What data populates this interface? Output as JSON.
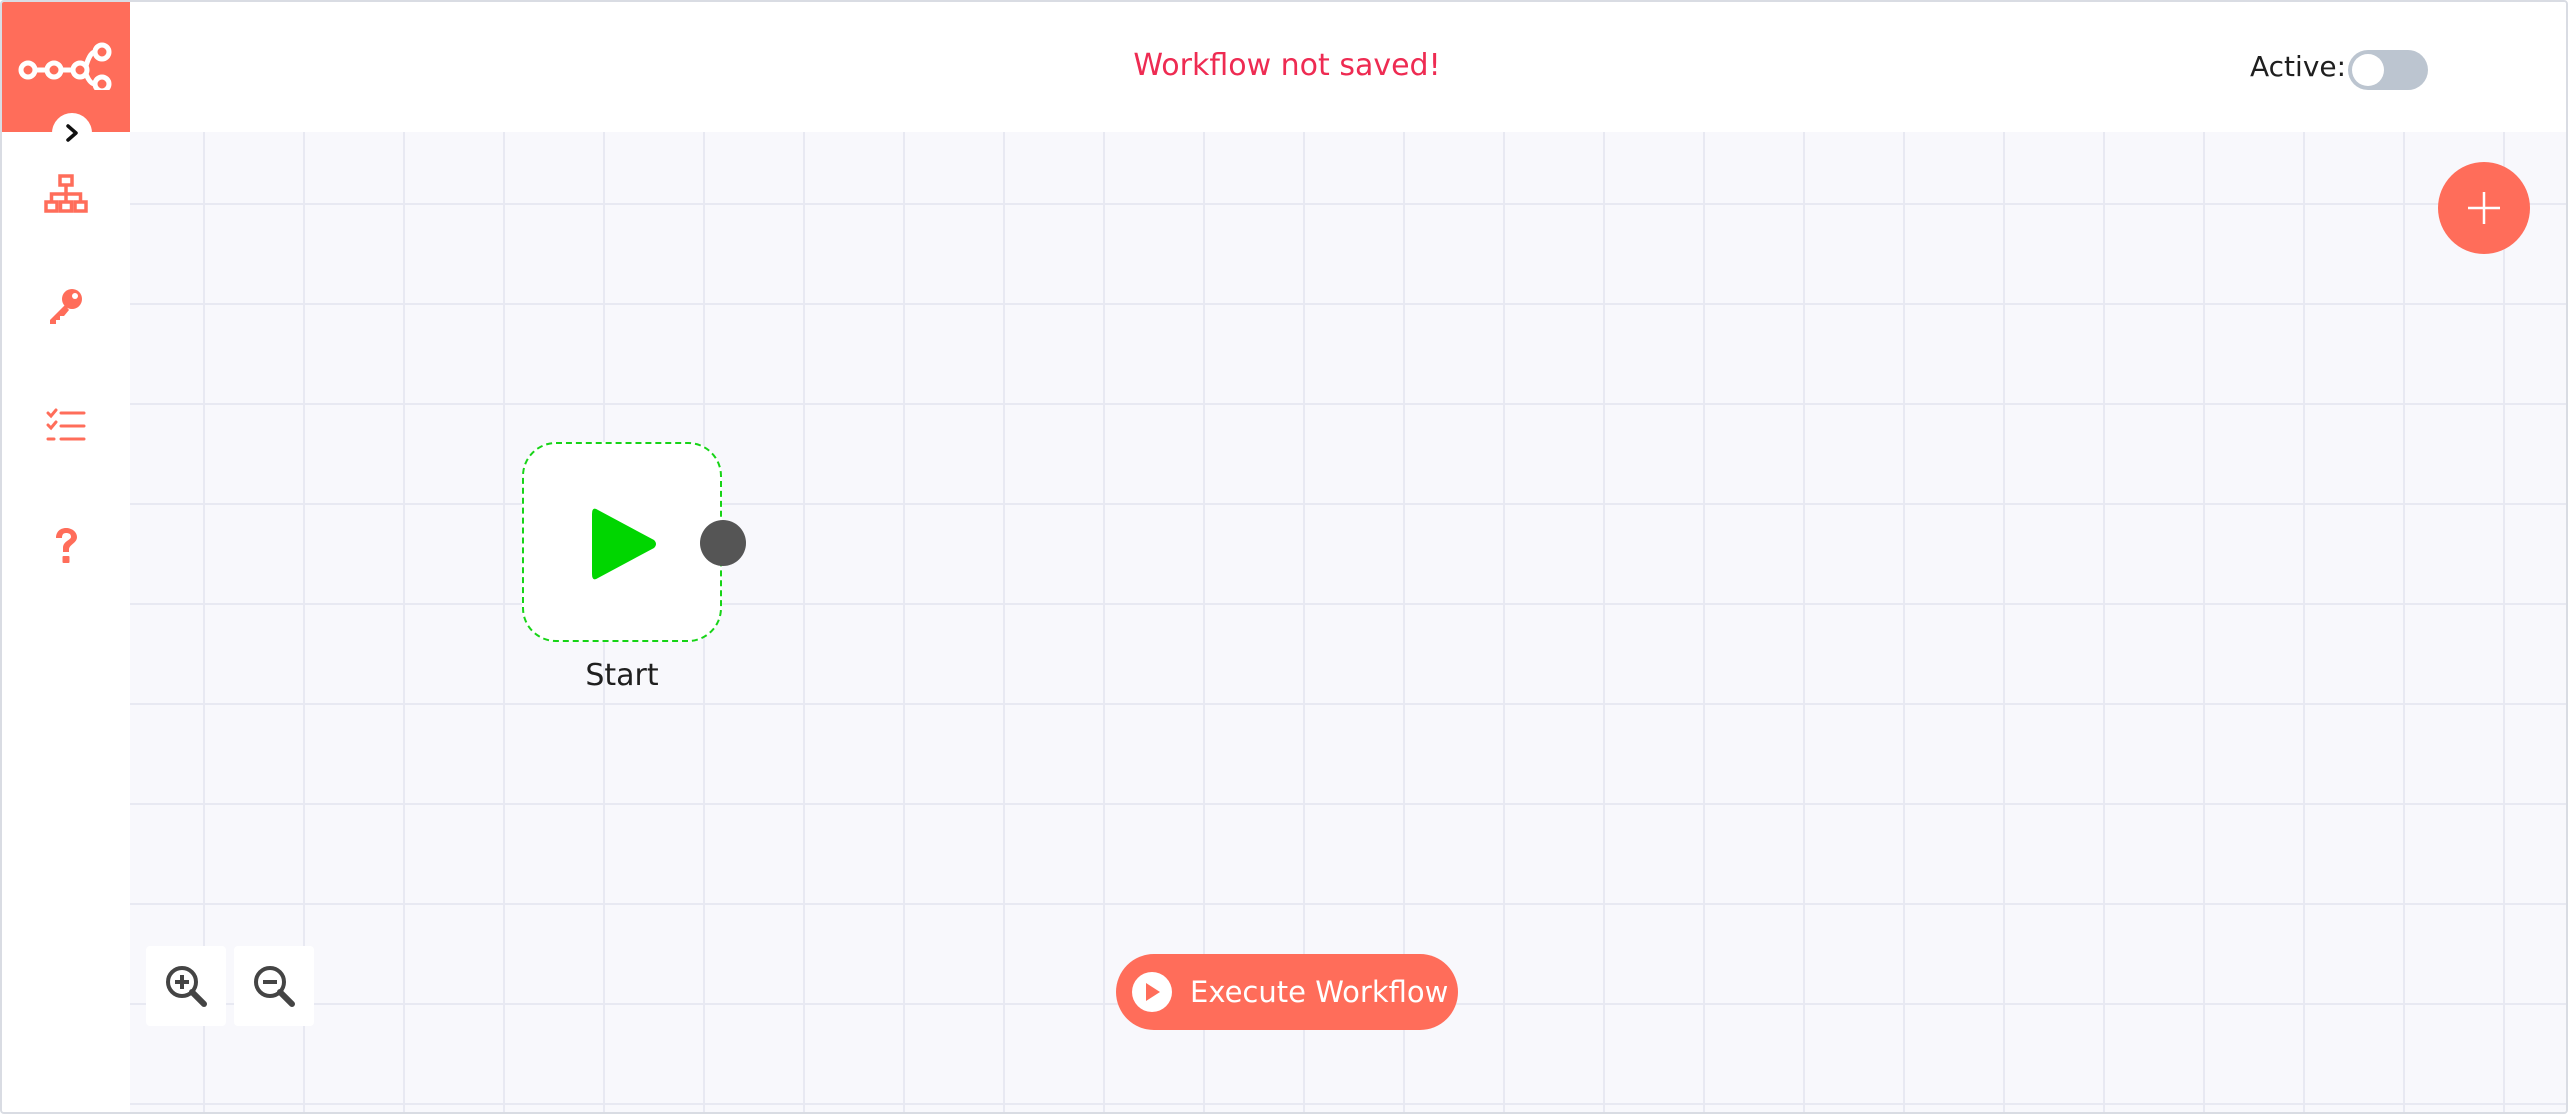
{
  "app": {
    "name": "n8n workflow editor",
    "accent_color": "#ff6d5a"
  },
  "sidebar": {
    "logo_icon": "n8n-logo-icon",
    "expand_icon": "chevron-right-icon",
    "items": [
      {
        "name": "workflows",
        "icon": "sitemap-icon"
      },
      {
        "name": "credentials",
        "icon": "key-icon"
      },
      {
        "name": "executions",
        "icon": "tasks-list-icon"
      },
      {
        "name": "help",
        "icon": "question-icon"
      }
    ]
  },
  "header": {
    "save_status": "Workflow not saved!",
    "save_status_color": "#ee2b52",
    "active_label": "Active:",
    "active_state": "off"
  },
  "canvas": {
    "add_node_icon": "plus-icon",
    "nodes": [
      {
        "label": "Start",
        "icon": "play-icon",
        "icon_color": "#00d600",
        "border_color": "#17d417"
      }
    ],
    "zoom_in_icon": "zoom-in-icon",
    "zoom_out_icon": "zoom-out-icon",
    "execute_button": {
      "label": "Execute Workflow",
      "icon": "play-circle-icon"
    }
  }
}
